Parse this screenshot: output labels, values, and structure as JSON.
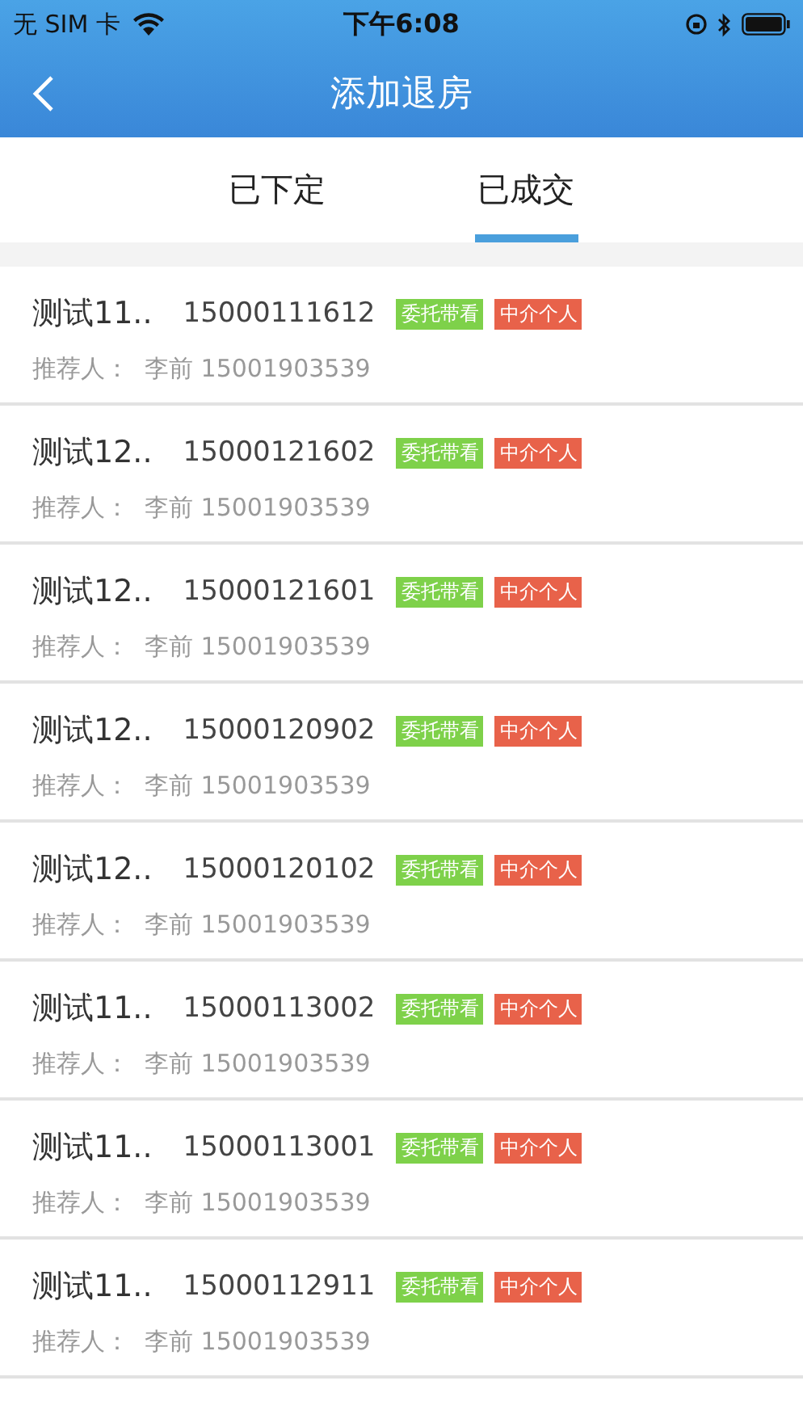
{
  "status_bar": {
    "carrier": "无 SIM 卡",
    "time": "下午6:08"
  },
  "nav": {
    "title": "添加退房"
  },
  "tabs": [
    {
      "label": "已下定",
      "selected": false
    },
    {
      "label": "已成交",
      "selected": true
    }
  ],
  "rows": [
    {
      "name": "测试11..",
      "phone": "15000111612",
      "tags": [
        {
          "label": "委托带看",
          "color": "#7ed14a"
        },
        {
          "label": "中介个人",
          "color": "#e8624a"
        }
      ],
      "referrer": "推荐人：  李前 15001903539"
    },
    {
      "name": "测试12..",
      "phone": "15000121602",
      "tags": [
        {
          "label": "委托带看",
          "color": "#7ed14a"
        },
        {
          "label": "中介个人",
          "color": "#e8624a"
        }
      ],
      "referrer": "推荐人：  李前 15001903539"
    },
    {
      "name": "测试12..",
      "phone": "15000121601",
      "tags": [
        {
          "label": "委托带看",
          "color": "#7ed14a"
        },
        {
          "label": "中介个人",
          "color": "#e8624a"
        }
      ],
      "referrer": "推荐人：  李前 15001903539"
    },
    {
      "name": "测试12..",
      "phone": "15000120902",
      "tags": [
        {
          "label": "委托带看",
          "color": "#7ed14a"
        },
        {
          "label": "中介个人",
          "color": "#e8624a"
        }
      ],
      "referrer": "推荐人：  李前 15001903539"
    },
    {
      "name": "测试12..",
      "phone": "15000120102",
      "tags": [
        {
          "label": "委托带看",
          "color": "#7ed14a"
        },
        {
          "label": "中介个人",
          "color": "#e8624a"
        }
      ],
      "referrer": "推荐人：  李前 15001903539"
    },
    {
      "name": "测试11..",
      "phone": "15000113002",
      "tags": [
        {
          "label": "委托带看",
          "color": "#7ed14a"
        },
        {
          "label": "中介个人",
          "color": "#e8624a"
        }
      ],
      "referrer": "推荐人：  李前 15001903539"
    },
    {
      "name": "测试11..",
      "phone": "15000113001",
      "tags": [
        {
          "label": "委托带看",
          "color": "#7ed14a"
        },
        {
          "label": "中介个人",
          "color": "#e8624a"
        }
      ],
      "referrer": "推荐人：  李前 15001903539"
    },
    {
      "name": "测试11..",
      "phone": "15000112911",
      "tags": [
        {
          "label": "委托带看",
          "color": "#7ed14a"
        },
        {
          "label": "中介个人",
          "color": "#e8624a"
        }
      ],
      "referrer": "推荐人：  李前 15001903539"
    }
  ]
}
